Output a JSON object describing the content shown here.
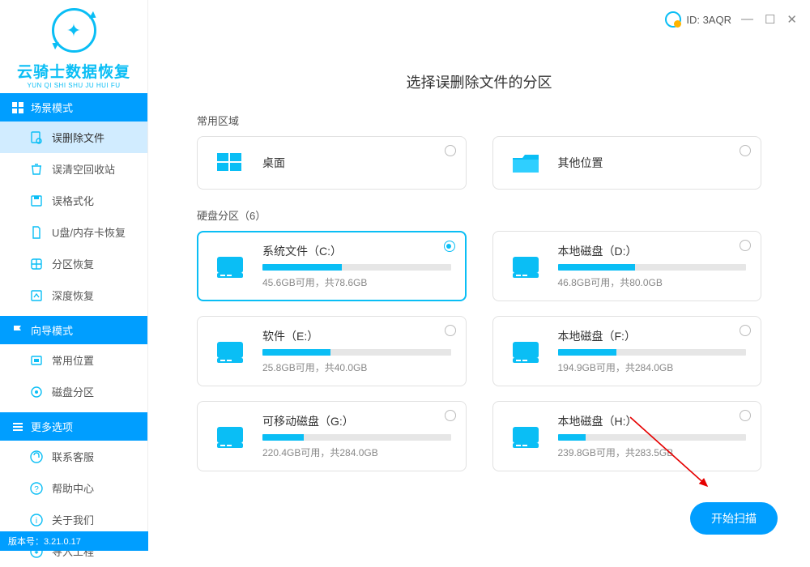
{
  "titlebar": {
    "id_label": "ID: 3AQR"
  },
  "brand": {
    "name": "云骑士数据恢复",
    "sub": "YUN QI SHI SHU JU HUI FU"
  },
  "sidebar": {
    "section1": {
      "header": "场景模式",
      "items": [
        {
          "label": "误删除文件"
        },
        {
          "label": "误清空回收站"
        },
        {
          "label": "误格式化"
        },
        {
          "label": "U盘/内存卡恢复"
        },
        {
          "label": "分区恢复"
        },
        {
          "label": "深度恢复"
        }
      ]
    },
    "section2": {
      "header": "向导模式",
      "items": [
        {
          "label": "常用位置"
        },
        {
          "label": "磁盘分区"
        }
      ]
    },
    "section3": {
      "header": "更多选项",
      "items": [
        {
          "label": "联系客服"
        },
        {
          "label": "帮助中心"
        },
        {
          "label": "关于我们"
        },
        {
          "label": "导入工程"
        }
      ]
    }
  },
  "page": {
    "title": "选择误删除文件的分区"
  },
  "common_area": {
    "label": "常用区域",
    "cards": [
      {
        "title": "桌面"
      },
      {
        "title": "其他位置"
      }
    ]
  },
  "disks": {
    "label": "硬盘分区（6）",
    "items": [
      {
        "title": "系统文件（C:）",
        "sub": "45.6GB可用，共78.6GB",
        "used_pct": 42
      },
      {
        "title": "本地磁盘（D:）",
        "sub": "46.8GB可用，共80.0GB",
        "used_pct": 41
      },
      {
        "title": "软件（E:）",
        "sub": "25.8GB可用，共40.0GB",
        "used_pct": 36
      },
      {
        "title": "本地磁盘（F:）",
        "sub": "194.9GB可用，共284.0GB",
        "used_pct": 31
      },
      {
        "title": "可移动磁盘（G:）",
        "sub": "220.4GB可用，共284.0GB",
        "used_pct": 22
      },
      {
        "title": "本地磁盘（H:）",
        "sub": "239.8GB可用，共283.5GB",
        "used_pct": 15
      }
    ]
  },
  "scan_button": "开始扫描",
  "version": "版本号：3.21.0.17"
}
